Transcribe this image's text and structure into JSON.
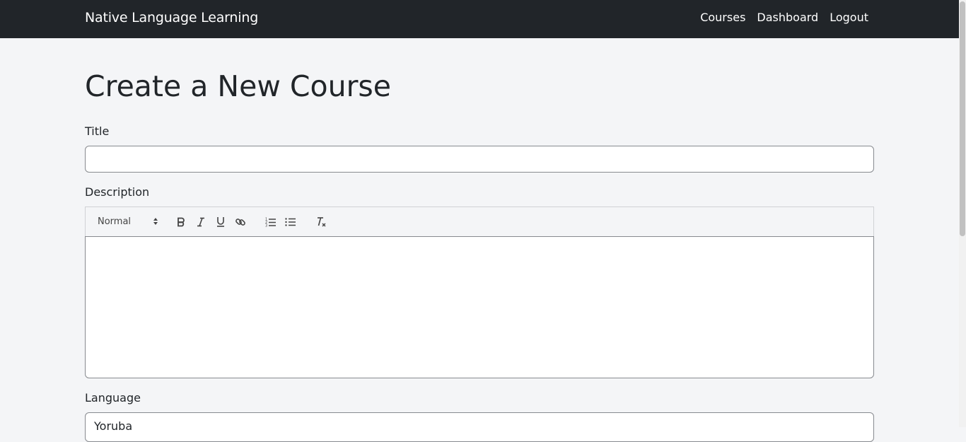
{
  "navbar": {
    "brand": "Native Language Learning",
    "links": [
      "Courses",
      "Dashboard",
      "Logout"
    ]
  },
  "page": {
    "title": "Create a New Course"
  },
  "form": {
    "title_label": "Title",
    "title_value": "",
    "description_label": "Description",
    "editor_toolbar": {
      "header_select": "Normal",
      "buttons": [
        "bold-icon",
        "italic-icon",
        "underline-icon",
        "link-icon",
        "ordered-list-icon",
        "bullet-list-icon",
        "clear-format-icon"
      ]
    },
    "description_value": "",
    "language_label": "Language",
    "language_value": "Yoruba"
  },
  "colors": {
    "navbar_bg": "#212529",
    "page_bg": "#f4f5f7",
    "text": "#212529",
    "input_border": "#878a8f"
  }
}
